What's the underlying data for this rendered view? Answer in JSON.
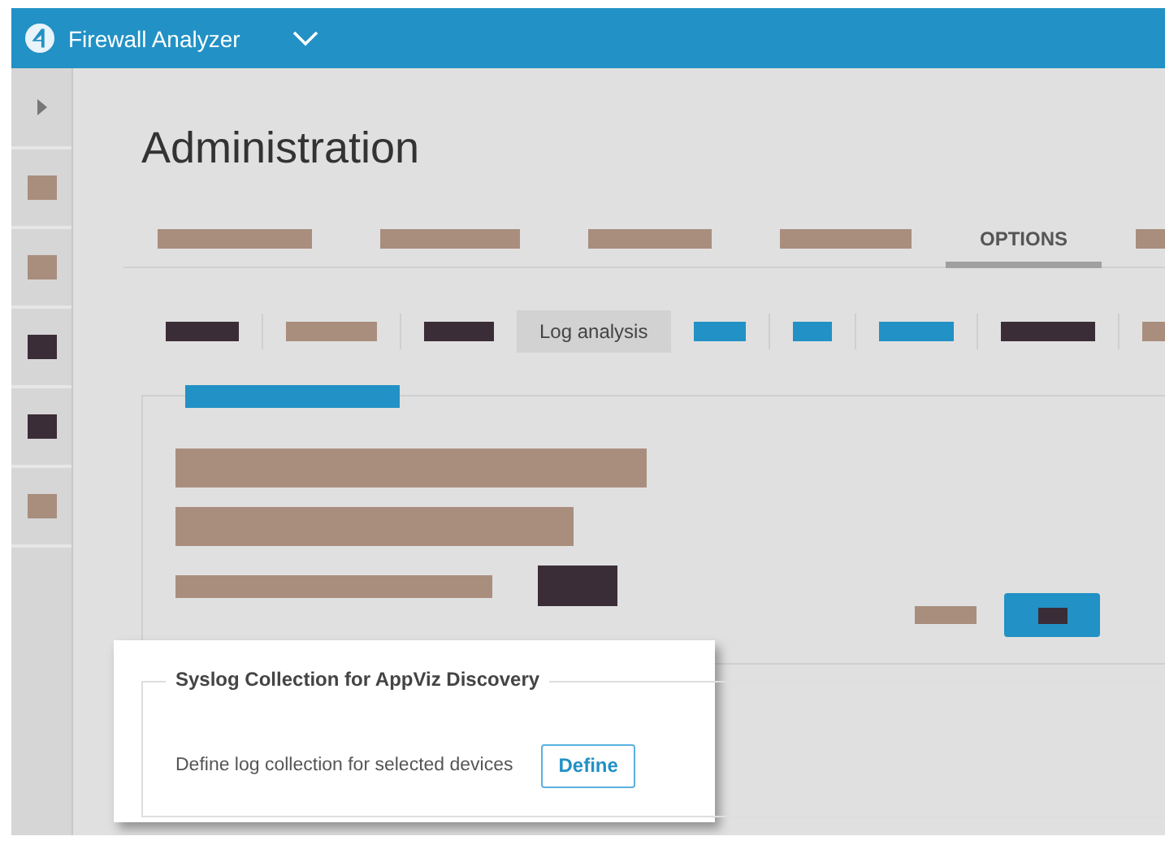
{
  "app": {
    "title": "Firewall Analyzer"
  },
  "sidebar": {
    "items": [
      {
        "color": "#a98e7e"
      },
      {
        "color": "#a98e7e"
      },
      {
        "color": "#3b2d37"
      },
      {
        "color": "#3b2d37"
      },
      {
        "color": "#a98e7e"
      }
    ]
  },
  "page_title": "Administration",
  "tabs": [
    {
      "kind": "redacted",
      "color": "#a98e7e",
      "selected": false
    },
    {
      "kind": "redacted",
      "color": "#a98e7e",
      "selected": false
    },
    {
      "kind": "redacted",
      "color": "#a98e7e",
      "selected": false
    },
    {
      "kind": "redacted",
      "color": "#a98e7e",
      "selected": false
    },
    {
      "kind": "label",
      "label": "OPTIONS",
      "selected": true
    },
    {
      "kind": "redacted",
      "color": "#a98e7e",
      "selected": false
    }
  ],
  "subtabs": [
    {
      "kind": "redacted",
      "color": "#3b2d37",
      "selected": false
    },
    {
      "kind": "redacted",
      "color": "#a98e7e",
      "selected": false
    },
    {
      "kind": "redacted",
      "color": "#3b2d37",
      "selected": false
    },
    {
      "kind": "label",
      "label": "Log analysis",
      "selected": true
    },
    {
      "kind": "redacted",
      "color": "#2291c5",
      "selected": false
    },
    {
      "kind": "redacted",
      "color": "#2291c5",
      "selected": false
    },
    {
      "kind": "redacted",
      "color": "#2291c5",
      "selected": false
    },
    {
      "kind": "redacted",
      "color": "#3b2d37",
      "selected": false
    },
    {
      "kind": "redacted",
      "color": "#a98e7e",
      "selected": false
    }
  ],
  "panel": {
    "legend": {
      "color": "#2291c5"
    },
    "lines": [
      {
        "color": "#a98e7e"
      },
      {
        "color": "#a98e7e"
      },
      {
        "color": "#a98e7e"
      }
    ],
    "inline_block": {
      "color": "#3b2d37"
    },
    "footer_label": {
      "color": "#a98e7e"
    },
    "button_label": {
      "color": "#3b2d37"
    }
  },
  "syslog": {
    "title": "Syslog Collection for AppViz Discovery",
    "text": "Define log collection for selected devices",
    "button": "Define"
  }
}
